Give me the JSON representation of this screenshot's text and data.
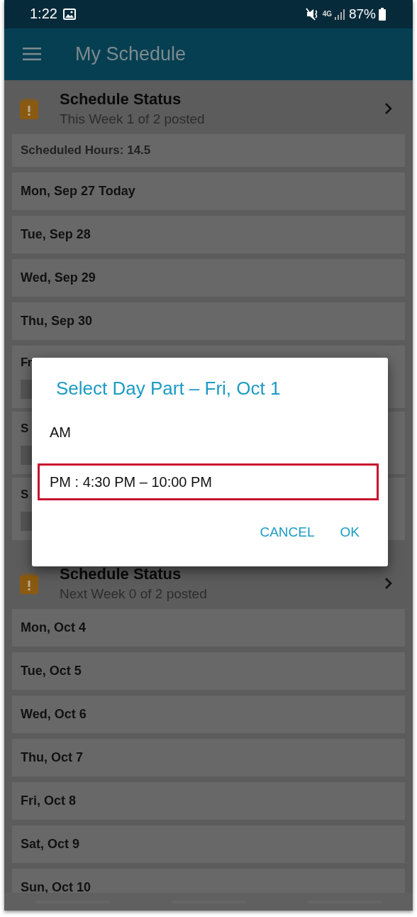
{
  "status_bar": {
    "time": "1:22",
    "network": "4G",
    "battery": "87%"
  },
  "app_bar": {
    "title": "My Schedule"
  },
  "weeks": [
    {
      "status_title": "Schedule Status",
      "status_subtitle": "This Week 1 of 2 posted",
      "hours": "Scheduled Hours: 14.5",
      "days": [
        {
          "label": "Mon, Sep 27 Today",
          "kind": "day"
        },
        {
          "label": "Tue, Sep 28",
          "kind": "day"
        },
        {
          "label": "Wed, Sep 29",
          "kind": "day"
        },
        {
          "label": "Thu, Sep 30",
          "kind": "day"
        },
        {
          "label": "Fr",
          "kind": "shift"
        },
        {
          "label": "S",
          "kind": "shift"
        },
        {
          "label": "S",
          "kind": "shift"
        }
      ]
    },
    {
      "status_title": "Schedule Status",
      "status_subtitle": "Next Week 0 of 2 posted",
      "days": [
        {
          "label": "Mon, Oct 4",
          "kind": "day"
        },
        {
          "label": "Tue, Oct 5",
          "kind": "day"
        },
        {
          "label": "Wed, Oct 6",
          "kind": "day"
        },
        {
          "label": "Thu, Oct 7",
          "kind": "day"
        },
        {
          "label": "Fri, Oct 8",
          "kind": "day"
        },
        {
          "label": "Sat, Oct 9",
          "kind": "day"
        },
        {
          "label": "Sun, Oct 10",
          "kind": "day"
        }
      ]
    }
  ],
  "dialog": {
    "title": "Select Day Part – Fri, Oct 1",
    "options": [
      {
        "label": "AM",
        "highlighted": false
      },
      {
        "label": "PM : 4:30 PM – 10:00 PM",
        "highlighted": true
      }
    ],
    "buttons": [
      "CANCEL",
      "OK"
    ]
  }
}
